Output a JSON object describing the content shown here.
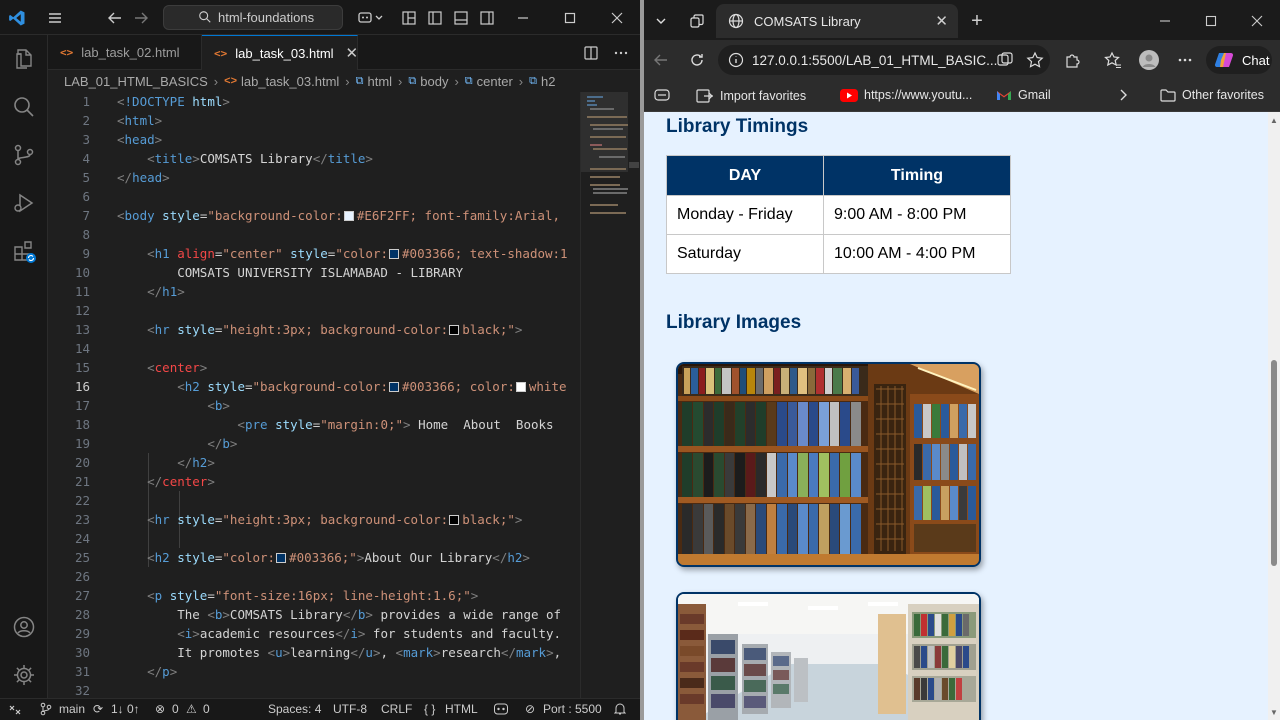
{
  "vscode": {
    "search": "html-foundations",
    "tabs": [
      {
        "label": "lab_task_02.html"
      },
      {
        "label": "lab_task_03.html"
      }
    ],
    "breadcrumb": [
      "LAB_01_HTML_BASICS",
      "lab_task_03.html",
      "html",
      "body",
      "center",
      "h2"
    ],
    "line_numbers": [
      "1",
      "2",
      "3",
      "4",
      "5",
      "6",
      "7",
      "8",
      "9",
      "10",
      "11",
      "12",
      "13",
      "14",
      "15",
      "16",
      "17",
      "18",
      "19",
      "20",
      "21",
      "22",
      "23",
      "24",
      "25",
      "26",
      "27",
      "28",
      "29",
      "30",
      "31",
      "32"
    ],
    "status": {
      "branch": "main",
      "sync": "1↓ 0↑",
      "errors": "0",
      "warnings": "0",
      "spaces": "Spaces: 4",
      "encoding": "UTF-8",
      "eol": "CRLF",
      "language": "HTML",
      "port": "Port : 5500"
    }
  },
  "browser": {
    "tab_title": "COMSATS Library",
    "url": "127.0.0.1:5500/LAB_01_HTML_BASIC...",
    "chat_label": "Chat",
    "favorites": {
      "import": "Import favorites",
      "youtube": "https://www.youtu...",
      "gmail": "Gmail",
      "other": "Other favorites"
    },
    "page": {
      "timings_heading": "Library Timings",
      "table": {
        "headers": [
          "DAY",
          "Timing"
        ],
        "rows": [
          [
            "Monday - Friday",
            "9:00 AM - 8:00 PM"
          ],
          [
            "Saturday",
            "10:00 AM - 4:00 PM"
          ]
        ]
      },
      "images_heading": "Library Images"
    }
  },
  "colors": {
    "accent": "#0078d4",
    "page_bg": "#E6F2FF",
    "heading": "#003366"
  }
}
